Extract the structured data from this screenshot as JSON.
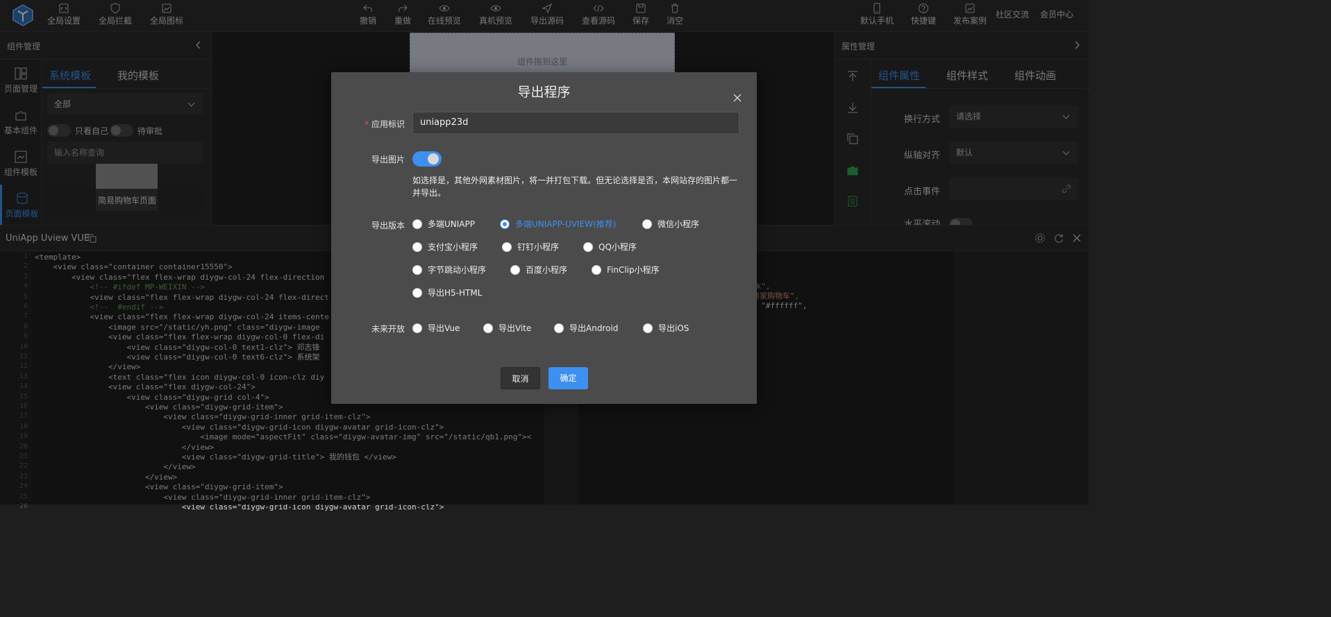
{
  "toolbar": {
    "left": [
      {
        "label": "全局设置",
        "icon": "code-icon"
      },
      {
        "label": "全局拦截",
        "icon": "shield-icon"
      },
      {
        "label": "全局图标",
        "icon": "image-icon"
      }
    ],
    "center": [
      {
        "label": "撤销",
        "icon": "undo-icon"
      },
      {
        "label": "重做",
        "icon": "redo-icon"
      },
      {
        "label": "在线预览",
        "icon": "eye-icon"
      },
      {
        "label": "真机预览",
        "icon": "eye-icon"
      },
      {
        "label": "导出源码",
        "icon": "send-icon"
      },
      {
        "label": "查看源码",
        "icon": "code-icon"
      },
      {
        "label": "保存",
        "icon": "save-icon"
      },
      {
        "label": "消空",
        "icon": "trash-icon"
      }
    ],
    "right": [
      {
        "label": "默认手机",
        "icon": "phone-icon"
      },
      {
        "label": "快捷键",
        "icon": "help-icon"
      },
      {
        "label": "发布案例",
        "icon": "image-icon"
      }
    ],
    "links": [
      "社区交流",
      "会员中心"
    ]
  },
  "left_panel": {
    "title": "组件管理",
    "nav": [
      "页面管理",
      "基本组件",
      "组件模板",
      "页面模板"
    ],
    "tabs": [
      "系统模板",
      "我的模板"
    ],
    "category_select": "全部",
    "switch_labels": [
      "只看自己",
      "待审批"
    ],
    "search_placeholder": "输入名称查询",
    "template_caption": "简易购物车页面"
  },
  "canvas": {
    "drop_hint": "组件拖到这里"
  },
  "right_panel": {
    "title": "属性管理",
    "tabs": [
      "组件属性",
      "组件样式",
      "组件动画"
    ],
    "rows": [
      {
        "label": "换行方式",
        "value": "请选择"
      },
      {
        "label": "纵轴对齐",
        "value": "默认"
      },
      {
        "label": "点击事件",
        "value": ""
      },
      {
        "label": "水平滚动",
        "value": ""
      }
    ]
  },
  "editor": {
    "title": "UniApp Uview VUE",
    "lines": [
      "<template>",
      "    <view class=\"container container15550\">",
      "        <view class=\"flex flex-wrap diygw-col-24 flex-direction",
      "            <!-- #ifdef MP-WEIXIN -->",
      "            <view class=\"flex flex-wrap diygw-col-24 flex-direct",
      "            <!--  #endif -->",
      "            <view class=\"flex flex-wrap diygw-col-24 items-cente",
      "                <image src=\"/static/yh.png\" class=\"diygw-image",
      "                <view class=\"flex flex-wrap diygw-col-0 flex-di",
      "                    <view class=\"diygw-col-0 text1-clz\"> 邓志锋",
      "                    <view class=\"diygw-col-0 text6-clz\"> 系统架",
      "                </view>",
      "                <text class=\"flex icon diygw-col-0 icon-clz diy",
      "                <view class=\"flex diygw-col-24\">",
      "                    <view class=\"diygw-grid col-4\">",
      "                        <view class=\"diygw-grid-item\">",
      "                            <view class=\"diygw-grid-inner grid-item-clz\">",
      "                                <view class=\"diygw-grid-icon diygw-avatar grid-icon-clz\">",
      "                                    <image mode=\"aspectFit\" class=\"diygw-avatar-img\" src=\"/static/qb1.png\"><",
      "                                </view>",
      "                                <view class=\"diygw-grid-title\"> 我的钱包 </view>",
      "                            </view>",
      "                        </view>",
      "                        <view class=\"diygw-grid-item\">",
      "                            <view class=\"diygw-grid-inner grid-item-clz\">",
      "                                <view class=\"diygw-grid-icon diygw-avatar grid-icon-clz\">"
    ],
    "right_snippets": [
      "ck\",",
      "商家购物车\",",
      ": \"#ffffff\","
    ]
  },
  "dialog": {
    "title": "导出程序",
    "app_id_label": "应用标识",
    "app_id_value": "uniapp23d",
    "export_images_label": "导出图片",
    "export_images_on": true,
    "help_text": "如选择是，其他外网素材图片，将一并打包下载。但无论选择是否，本网站存的图片都一并导出。",
    "version_label": "导出版本",
    "versions": [
      {
        "label": "多端UNIAPP",
        "checked": false
      },
      {
        "label": "多端UNIAPP-UVIEW(推荐)",
        "checked": true
      },
      {
        "label": "微信小程序",
        "checked": false
      },
      {
        "label": "支付宝小程序",
        "checked": false
      },
      {
        "label": "钉钉小程序",
        "checked": false
      },
      {
        "label": "QQ小程序",
        "checked": false
      },
      {
        "label": "字节跳动小程序",
        "checked": false
      },
      {
        "label": "百度小程序",
        "checked": false
      },
      {
        "label": "FinClip小程序",
        "checked": false
      },
      {
        "label": "导出H5-HTML",
        "checked": false
      }
    ],
    "future_label": "未来开放",
    "future": [
      {
        "label": "导出Vue"
      },
      {
        "label": "导出Vite"
      },
      {
        "label": "导出Android"
      },
      {
        "label": "导出iOS"
      }
    ],
    "cancel_label": "取消",
    "ok_label": "确定"
  }
}
